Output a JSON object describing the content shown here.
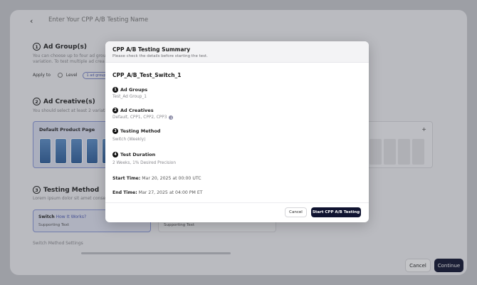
{
  "header": {
    "back_icon": "chevron-left-icon",
    "name_placeholder": "Enter Your CPP A/B Testing Name"
  },
  "section1": {
    "number": "1",
    "title": "Ad Group(s)",
    "desc_line1": "You can choose up to four ad grou",
    "desc_line2": "variation. To test multiple ad crea",
    "apply_label": "Apply to",
    "radio_label": "Level",
    "pill_label": "1 ad group"
  },
  "section2": {
    "number": "2",
    "title": "Ad Creative(s)",
    "desc": "You should select at least 2 variati",
    "card_title": "Default Product Page",
    "plus_icon": "+"
  },
  "section3": {
    "number": "3",
    "title": "Testing Method",
    "desc": "Lorem ipsum dolor sit amet conse",
    "option1_name": "Switch",
    "option1_link": "How It Works?",
    "option1_support": "Supporting Text",
    "option2_support": "Supporting Text"
  },
  "switch_settings_label": "Switch Method Settings",
  "footer": {
    "cancel": "Cancel",
    "continue": "Continue"
  },
  "modal": {
    "title": "CPP A/B Testing Summary",
    "subtitle": "Please check the details before starting the test.",
    "test_name": "CPP_A/B_Test_Switch_1",
    "items": [
      {
        "number": "1",
        "label": "Ad Groups",
        "value": "Test_Ad Group_1"
      },
      {
        "number": "2",
        "label": "Ad Creatives",
        "value": "Default, CPP1, CPP2, CPP3"
      },
      {
        "number": "3",
        "label": "Testing Method",
        "value": "Switch (Weekly)"
      },
      {
        "number": "4",
        "label": "Test Duration",
        "value": "2 Weeks, 1% Desired Precision"
      }
    ],
    "start_label": "Start Time:",
    "start_value": "Mar 20, 2025 at 00:00 UTC",
    "end_label": "End Time:",
    "end_value": "Mar 27, 2025 at 04:00 PM ET",
    "info_icon": "i",
    "cancel": "Cancel",
    "start_button": "Start CPP A/B Testing"
  },
  "colors": {
    "primary_dark": "#0f1330",
    "accent": "#4a58b5",
    "selected_bg": "#dde1f2"
  }
}
